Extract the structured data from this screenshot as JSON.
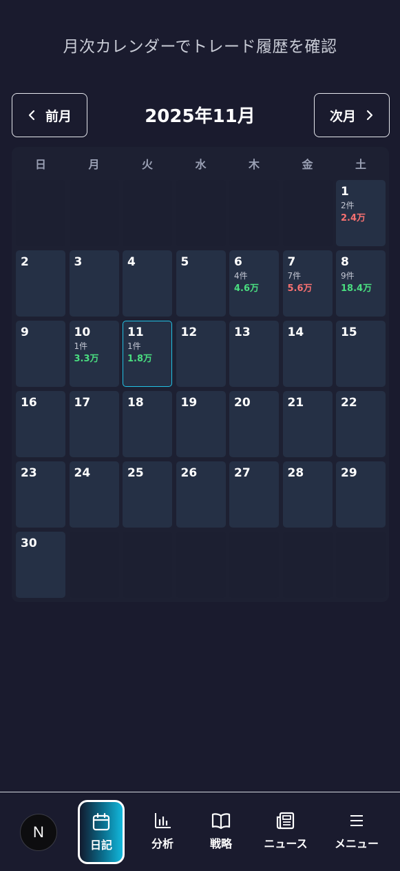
{
  "header": {
    "subtitle": "月次カレンダーでトレード履歴を確認",
    "prev_label": "前月",
    "next_label": "次月",
    "month_title": "2025年11月"
  },
  "weekdays": [
    "日",
    "月",
    "火",
    "水",
    "木",
    "金",
    "土"
  ],
  "calendar": {
    "leading_empty_cells": 6,
    "days": [
      {
        "day": "1",
        "count": "2件",
        "amount": "2.4万",
        "sign": "neg"
      },
      {
        "day": "2"
      },
      {
        "day": "3"
      },
      {
        "day": "4"
      },
      {
        "day": "5"
      },
      {
        "day": "6",
        "count": "4件",
        "amount": "4.6万",
        "sign": "pos"
      },
      {
        "day": "7",
        "count": "7件",
        "amount": "5.6万",
        "sign": "neg"
      },
      {
        "day": "8",
        "count": "9件",
        "amount": "18.4万",
        "sign": "pos"
      },
      {
        "day": "9"
      },
      {
        "day": "10",
        "count": "1件",
        "amount": "3.3万",
        "sign": "pos"
      },
      {
        "day": "11",
        "count": "1件",
        "amount": "1.8万",
        "sign": "pos",
        "selected": true
      },
      {
        "day": "12"
      },
      {
        "day": "13"
      },
      {
        "day": "14"
      },
      {
        "day": "15"
      },
      {
        "day": "16"
      },
      {
        "day": "17"
      },
      {
        "day": "18"
      },
      {
        "day": "19"
      },
      {
        "day": "20"
      },
      {
        "day": "21"
      },
      {
        "day": "22"
      },
      {
        "day": "23"
      },
      {
        "day": "24"
      },
      {
        "day": "25"
      },
      {
        "day": "26"
      },
      {
        "day": "27"
      },
      {
        "day": "28"
      },
      {
        "day": "29"
      },
      {
        "day": "30"
      }
    ]
  },
  "bottom_nav": {
    "badge_letter": "N",
    "items": [
      {
        "label": "日記",
        "icon": "calendar-icon",
        "active": true
      },
      {
        "label": "分析",
        "icon": "bar-chart-icon"
      },
      {
        "label": "戦略",
        "icon": "book-icon"
      },
      {
        "label": "ニュース",
        "icon": "newspaper-icon"
      },
      {
        "label": "メニュー",
        "icon": "hamburger-menu-icon"
      }
    ]
  },
  "colors": {
    "background": "#1a1b2e",
    "cell": "#253045",
    "positive": "#4ade80",
    "negative": "#f87171",
    "selected_border": "#22c3e6"
  }
}
